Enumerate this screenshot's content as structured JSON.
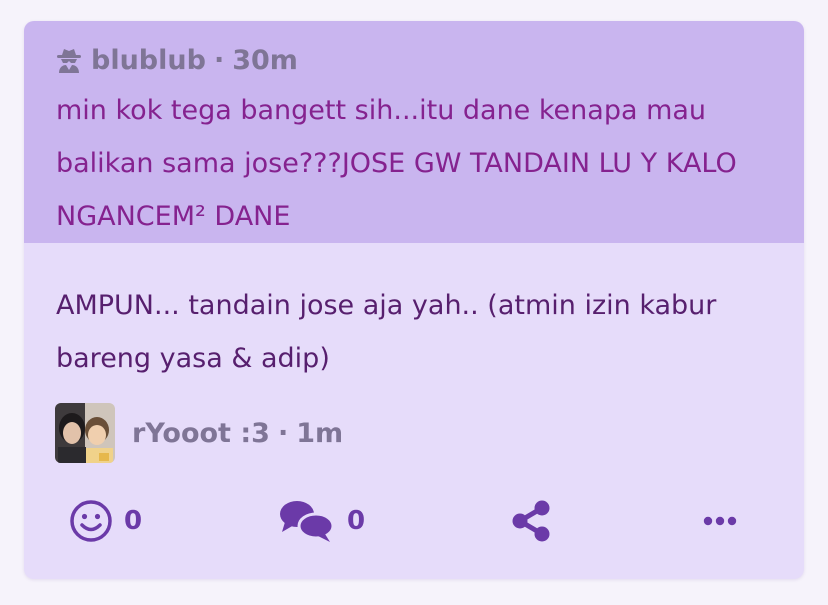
{
  "question": {
    "author": "blublub",
    "separator": "·",
    "time": "30m",
    "author_icon": "spy-icon",
    "text": "min kok tega bangett sih...itu dane kenapa mau balikan sama jose???JOSE GW TANDAIN LU Y KALO NGANCEM² DANE"
  },
  "answer": {
    "text": "AMPUN... tandain jose aja yah.. (atmin izin kabur bareng yasa & adip)",
    "author": "rYooot :3",
    "separator": "·",
    "time": "1m",
    "avatar_icon": "avatar-photo"
  },
  "actions": {
    "reaction_icon": "smiley-icon",
    "reaction_count": "0",
    "comment_icon": "comments-icon",
    "comment_count": "0",
    "share_icon": "share-icon",
    "more_icon": "more-dots-icon"
  },
  "colors": {
    "question_bg": "#c9b5ef",
    "card_bg": "#e6dcfa",
    "question_text": "#85228f",
    "answer_text": "#571f6e",
    "meta_text": "#7f7596",
    "icon_purple": "#6b3aa8"
  }
}
